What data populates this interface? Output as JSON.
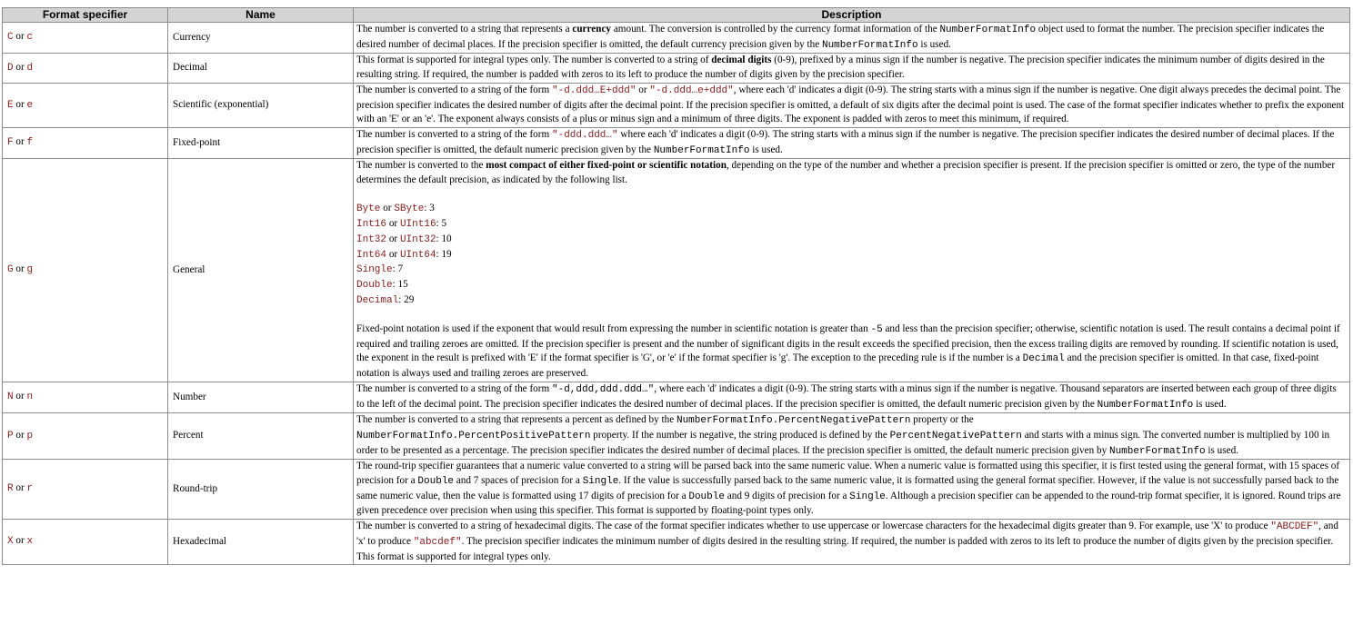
{
  "headers": {
    "specifier": "Format specifier",
    "name": "Name",
    "description": "Description"
  },
  "rows": {
    "C": {
      "upper": "C",
      "or": "or",
      "lower": "c",
      "name": "Currency",
      "d1": "The number is converted to a string that represents a ",
      "b1": "currency",
      "d2": " amount. The conversion is controlled by the currency format information of the ",
      "c1": "NumberFormatInfo",
      "d3": " object used to format the number. The precision specifier indicates the desired number of decimal places. If the precision specifier is omitted, the default currency precision given by the ",
      "c2": "NumberFormatInfo",
      "d4": " is used."
    },
    "D": {
      "upper": "D",
      "or": "or",
      "lower": "d",
      "name": "Decimal",
      "d1": "This format is supported for integral types only. The number is converted to a string of ",
      "b1": "decimal digits",
      "d2": " (0-9), prefixed by a minus sign if the number is negative. The precision specifier indicates the minimum number of digits desired in the resulting string. If required, the number is padded with zeros to its left to produce the number of digits given by the precision specifier."
    },
    "E": {
      "upper": "E",
      "or": "or",
      "lower": "e",
      "name": "Scientific (exponential)",
      "d1": "The number is converted to a string of the form ",
      "c1": "\"-d.ddd…E+ddd\"",
      "d2": " or ",
      "c2": "\"-d.ddd…e+ddd\"",
      "d3": ", where each 'd' indicates a digit (0-9). The string starts with a minus sign if the number is negative. One digit always precedes the decimal point. The precision specifier indicates the desired number of digits after the decimal point. If the precision specifier is omitted, a default of six digits after the decimal point is used. The case of the format specifier indicates whether to prefix the exponent with an 'E' or an 'e'. The exponent always consists of a plus or minus sign and a minimum of three digits. The exponent is padded with zeros to meet this minimum, if required."
    },
    "F": {
      "upper": "F",
      "or": "or",
      "lower": "f",
      "name": "Fixed-point",
      "d1": "The number is converted to a string of the form ",
      "c1": "\"-ddd.ddd…\"",
      "d2": " where each 'd' indicates a digit (0-9). The string starts with a minus sign if the number is negative. The precision specifier indicates the desired number of decimal places. If the precision specifier is omitted, the default numeric precision given by the ",
      "c2": "NumberFormatInfo",
      "d3": " is used."
    },
    "G": {
      "upper": "G",
      "or": "or",
      "lower": "g",
      "name": "General",
      "d1": "The number is converted to the ",
      "b1": "most compact of either fixed-point or scientific notation",
      "d2": ", depending on the type of the number and whether a precision specifier is present. If the precision specifier is omitted or zero, the type of the number determines the default precision, as indicated by the following list.",
      "list": {
        "l1a": "Byte",
        "l1or": " or ",
        "l1b": "SByte",
        "l1v": ": 3",
        "l2a": "Int16",
        "l2or": " or ",
        "l2b": "UInt16",
        "l2v": ": 5",
        "l3a": "Int32",
        "l3or": " or ",
        "l3b": "UInt32",
        "l3v": ": 10",
        "l4a": "Int64",
        "l4or": " or ",
        "l4b": "UInt64",
        "l4v": ": 19",
        "l5a": "Single",
        "l5v": ": 7",
        "l6a": "Double",
        "l6v": ": 15",
        "l7a": "Decimal",
        "l7v": ": 29"
      },
      "p1": "Fixed-point notation is used if the exponent that would result from expressing the number in scientific notation is greater than ",
      "c1": "-5",
      "p2": " and less than the precision specifier; otherwise, scientific notation is used. The result contains a decimal point if required and trailing zeroes are omitted. If the precision specifier is present and the number of significant digits in the result exceeds the specified precision, then the excess trailing digits are removed by rounding. If scientific notation is used, the exponent in the result is prefixed with 'E' if the format specifier is 'G', or 'e' if the format specifier is 'g'. The exception to the preceding rule is if the number is a ",
      "c2": "Decimal",
      "p3": " and the precision specifier is omitted. In that case, fixed-point notation is always used and trailing zeroes are preserved."
    },
    "N": {
      "upper": "N",
      "or": "or",
      "lower": "n",
      "name": "Number",
      "d1": "The number is converted to a string of the form ",
      "c1": "\"-d,ddd,ddd.ddd…\"",
      "d2": ", where each 'd' indicates a digit (0-9). The string starts with a minus sign if the number is negative. Thousand separators are inserted between each group of three digits to the left of the decimal point. The precision specifier indicates the desired number of decimal places. If the precision specifier is omitted, the default numeric precision given by the ",
      "c2": "NumberFormatInfo",
      "d3": " is used."
    },
    "P": {
      "upper": "P",
      "or": "or",
      "lower": "p",
      "name": "Percent",
      "d1": "The number is converted to a string that represents a percent as defined by the ",
      "c1": "NumberFormatInfo.PercentNegativePattern",
      "d2": " property or the ",
      "c2": "NumberFormatInfo.PercentPositivePattern",
      "d3": " property. If the number is negative, the string produced is defined by the ",
      "c3": "PercentNegativePattern",
      "d4": " and starts with a minus sign. The converted number is multiplied by 100 in order to be presented as a percentage. The precision specifier indicates the desired number of decimal places. If the precision specifier is omitted, the default numeric precision given by ",
      "c4": "NumberFormatInfo",
      "d5": " is used."
    },
    "R": {
      "upper": "R",
      "or": "or",
      "lower": "r",
      "name": "Round-trip",
      "d1": "The round-trip specifier guarantees that a numeric value converted to a string will be parsed back into the same numeric value. When a numeric value is formatted using this specifier, it is first tested using the general format, with 15 spaces of precision for a ",
      "c1": "Double",
      "d2": " and 7 spaces of precision for a ",
      "c2": "Single",
      "d3": ". If the value is successfully parsed back to the same numeric value, it is formatted using the general format specifier. However, if the value is not successfully parsed back to the same numeric value, then the value is formatted using 17 digits of precision for a ",
      "c3": "Double",
      "d4": " and 9 digits of precision for a ",
      "c4": "Single",
      "d5": ". Although a precision specifier can be appended to the round-trip format specifier, it is ignored. Round trips are given precedence over precision when using this specifier. This format is supported by floating-point types only."
    },
    "X": {
      "upper": "X",
      "or": "or",
      "lower": "x",
      "name": "Hexadecimal",
      "d1": "The number is converted to a string of hexadecimal digits. The case of the format specifier indicates whether to use uppercase or lowercase characters for the hexadecimal digits greater than 9. For example, use 'X' to produce ",
      "c1": "\"ABCDEF\"",
      "d2": ", and 'x' to produce ",
      "c2": "\"abcdef\"",
      "d3": ". The precision specifier indicates the minimum number of digits desired in the resulting string. If required, the number is padded with zeros to its left to produce the number of digits given by the precision specifier. This format is supported for integral types only."
    }
  }
}
